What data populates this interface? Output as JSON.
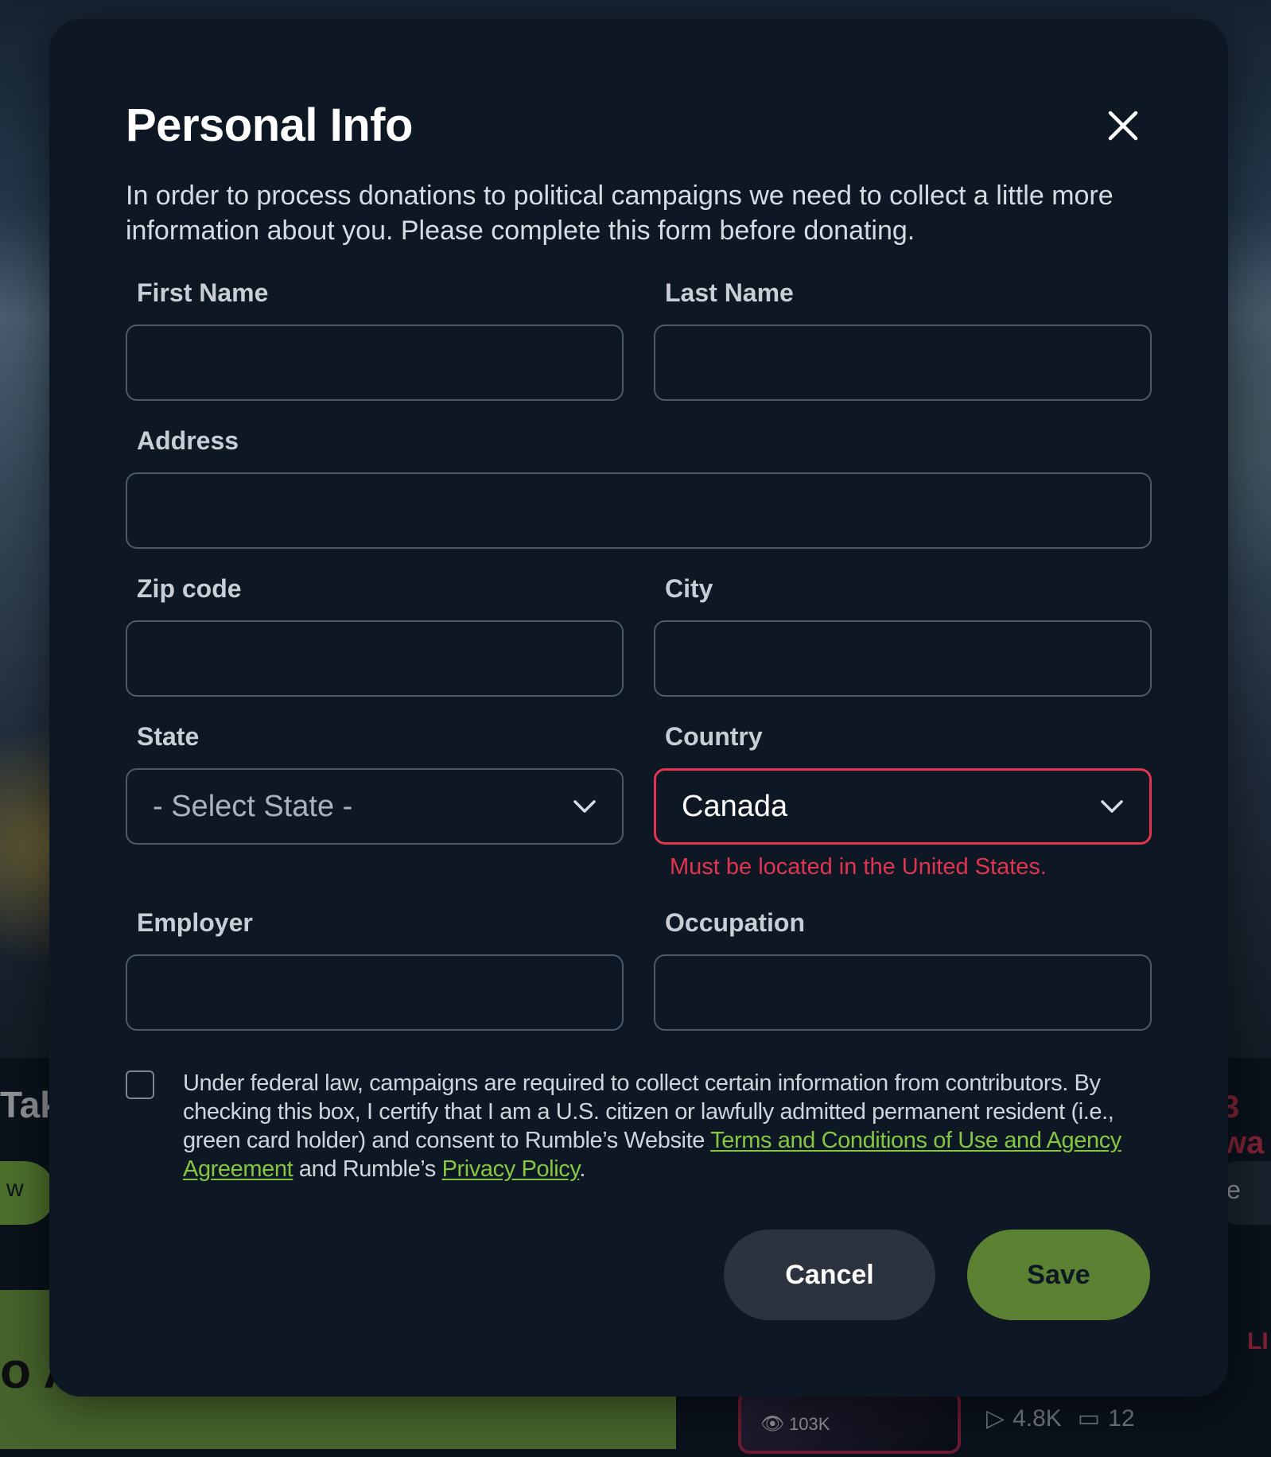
{
  "background": {
    "left_heading_fragment": "Tak",
    "right_heading_fragment": "3 wa",
    "left_pill_text": "w",
    "right_pill_text": "e",
    "bottom_left_fragment": "o A",
    "live_fragment": "LI",
    "thumb_views": "103K",
    "plays": "4.8K",
    "comments": "12"
  },
  "modal": {
    "title": "Personal Info",
    "description": "In order to process donations to political campaigns we need to collect a little more information about you. Please complete this form before donating.",
    "close_icon": "close-icon"
  },
  "form": {
    "first_name": {
      "label": "First Name",
      "value": ""
    },
    "last_name": {
      "label": "Last Name",
      "value": ""
    },
    "address": {
      "label": "Address",
      "value": ""
    },
    "zip": {
      "label": "Zip code",
      "value": ""
    },
    "city": {
      "label": "City",
      "value": ""
    },
    "state": {
      "label": "State",
      "value": "- Select State -"
    },
    "country": {
      "label": "Country",
      "value": "Canada",
      "error": "Must be located in the United States."
    },
    "employer": {
      "label": "Employer",
      "value": ""
    },
    "occupation": {
      "label": "Occupation",
      "value": ""
    }
  },
  "consent": {
    "checked": false,
    "text_before": "Under federal law, campaigns are required to collect certain information from contributors. By checking this box, I certify that I am a U.S. citizen or lawfully admitted permanent resident (i.e., green card holder) and consent to Rumble’s Website ",
    "terms_link": "Terms and Conditions of Use and Agency Agreement",
    "text_middle": " and Rumble’s ",
    "privacy_link": "Privacy Policy",
    "text_after": "."
  },
  "buttons": {
    "cancel": "Cancel",
    "save": "Save"
  },
  "colors": {
    "modal_bg": "#0d1824",
    "error": "#e0344f",
    "link": "#85c742",
    "save_bg": "#5a8232",
    "cancel_bg": "#2a333e"
  }
}
